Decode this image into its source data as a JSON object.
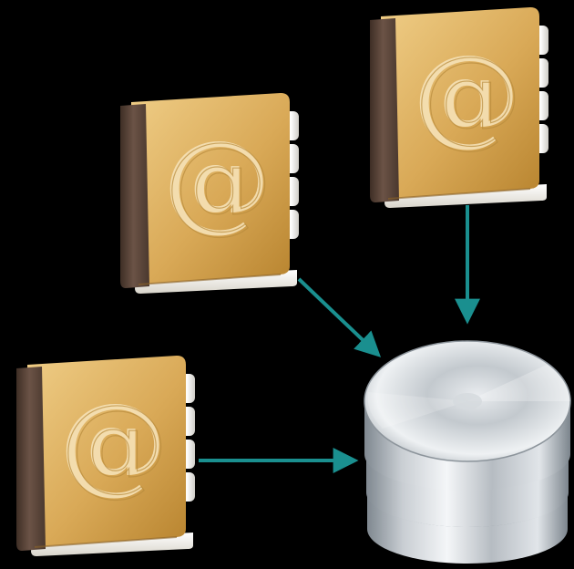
{
  "diagram": {
    "background": "#000000",
    "arrow_color": "#1a8f8f",
    "address_books": [
      {
        "id": "book-top-left",
        "icon": "address-book-icon",
        "glyph": "@"
      },
      {
        "id": "book-top-right",
        "icon": "address-book-icon",
        "glyph": "@"
      },
      {
        "id": "book-bottom-left",
        "icon": "address-book-icon",
        "glyph": "@"
      }
    ],
    "database": {
      "id": "database",
      "icon": "database-cylinder-icon"
    },
    "connections": [
      {
        "from": "book-top-left",
        "to": "database"
      },
      {
        "from": "book-top-right",
        "to": "database"
      },
      {
        "from": "book-bottom-left",
        "to": "database"
      }
    ],
    "colors": {
      "leather_light": "#e8c27a",
      "leather_dark": "#b8842f",
      "spine": "#5a4438",
      "pages": "#f4f1ea",
      "metal_light": "#f2f4f6",
      "metal_dark": "#8a939b"
    }
  }
}
